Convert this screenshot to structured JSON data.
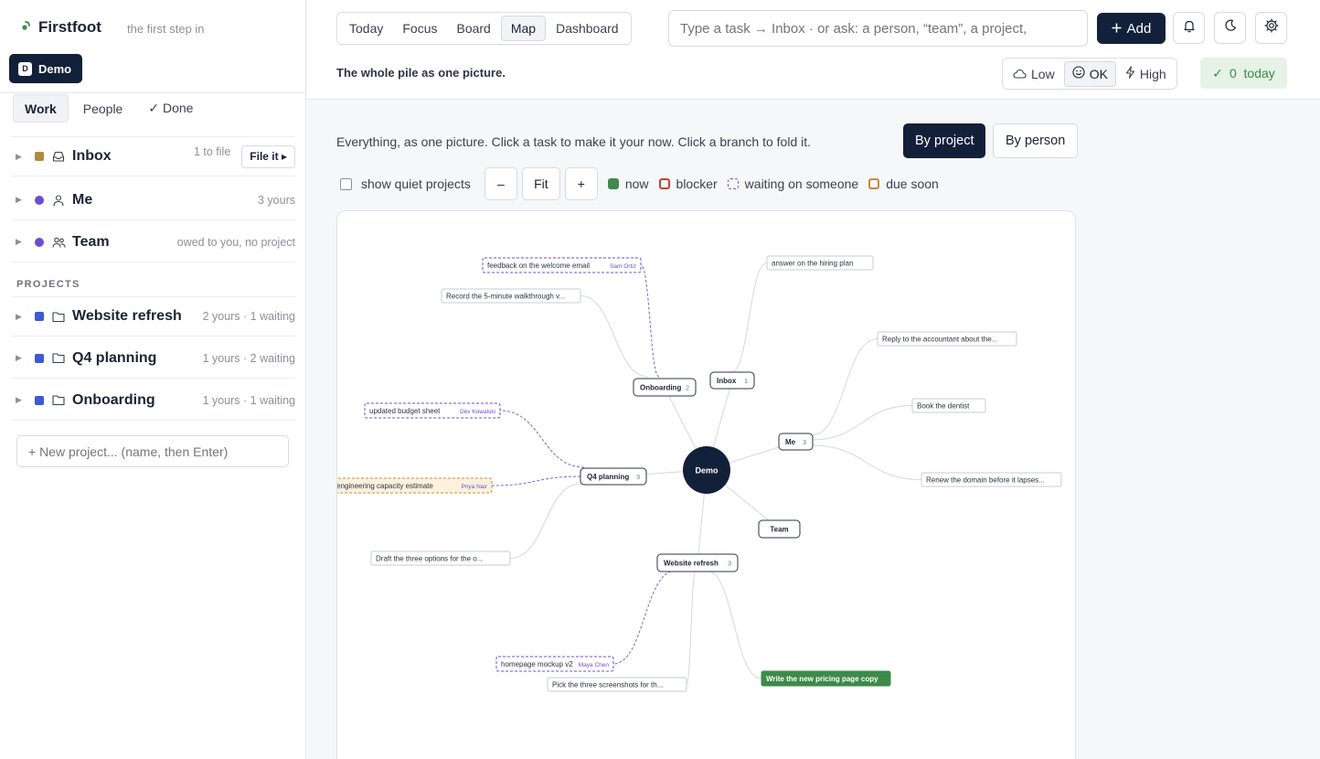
{
  "brand": {
    "name": "Firstfoot",
    "tagline": "the first step in"
  },
  "workspace": {
    "initial": "D",
    "name": "Demo"
  },
  "side_tabs": [
    {
      "label": "Work",
      "active": true
    },
    {
      "label": "People",
      "active": false
    },
    {
      "label": "✓ Done",
      "active": false
    }
  ],
  "buckets": [
    {
      "label": "Inbox",
      "meta": "1 to file",
      "action": "File it ▸",
      "color": "#b08a3e",
      "icon": "inbox-icon"
    },
    {
      "label": "Me",
      "meta": "3 yours",
      "color": "#6b4fd0",
      "icon": "person-icon"
    },
    {
      "label": "Team",
      "meta": "owed to you, no project",
      "color": "#6b4fd0",
      "icon": "people-icon"
    }
  ],
  "projects_label": "PROJECTS",
  "projects": [
    {
      "label": "Website refresh",
      "meta": "2 yours · 1 waiting",
      "color": "#3b5bd6",
      "icon": "folder-icon"
    },
    {
      "label": "Q4 planning",
      "meta": "1 yours · 2 waiting",
      "color": "#3b5bd6",
      "icon": "folder-icon"
    },
    {
      "label": "Onboarding",
      "meta": "1 yours · 1 waiting",
      "color": "#3b5bd6",
      "icon": "folder-icon"
    }
  ],
  "new_project_placeholder": "+ New project... (name, then Enter)",
  "views": [
    {
      "label": "Today",
      "active": false
    },
    {
      "label": "Focus",
      "active": false
    },
    {
      "label": "Board",
      "active": false
    },
    {
      "label": "Map",
      "active": true
    },
    {
      "label": "Dashboard",
      "active": false
    }
  ],
  "quick_add_placeholder": "Type a task → Inbox · or ask: a person, “team”, a project,",
  "add_label": "Add",
  "subtitle": "The whole pile as one picture.",
  "energy": [
    {
      "label": "Low",
      "icon": "cloud-icon",
      "active": false
    },
    {
      "label": "OK",
      "icon": "smile-icon",
      "active": true
    },
    {
      "label": "High",
      "icon": "bolt-icon",
      "active": false
    }
  ],
  "today_badge": {
    "check": "✓",
    "label": "0  today"
  },
  "intro": "Everything, as one picture. Click a task to make it your now. Click a branch to fold it.",
  "group_by": [
    {
      "label": "By project",
      "active": true
    },
    {
      "label": "By person",
      "active": false
    }
  ],
  "controls": {
    "quiet_label": "show quiet projects",
    "zoom_out": "–",
    "fit": "Fit",
    "zoom_in": "+"
  },
  "legend": [
    {
      "label": "now",
      "kind": "now",
      "color": "#3d8a4a"
    },
    {
      "label": "blocker",
      "kind": "blocker",
      "color": "#c2413b"
    },
    {
      "label": "waiting on someone",
      "kind": "waiting",
      "color": "#6b4fd0"
    },
    {
      "label": "due soon",
      "kind": "due",
      "color": "#c48a3a"
    }
  ],
  "map": {
    "root": "Demo",
    "hubs": [
      {
        "id": "onboarding",
        "label": "Onboarding",
        "count": "2"
      },
      {
        "id": "inbox",
        "label": "Inbox",
        "count": "1"
      },
      {
        "id": "me",
        "label": "Me",
        "count": "3"
      },
      {
        "id": "q4",
        "label": "Q4 planning",
        "count": "3"
      },
      {
        "id": "team",
        "label": "Team",
        "count": ""
      },
      {
        "id": "website",
        "label": "Website refresh",
        "count": "3"
      }
    ],
    "tasks": [
      {
        "hub": "onboarding",
        "label": "feedback on the welcome email",
        "person": "Sam Ortiz",
        "kind": "waiting"
      },
      {
        "hub": "onboarding",
        "label": "Record the 5-minute walkthrough v...",
        "kind": "normal"
      },
      {
        "hub": "inbox",
        "label": "answer on the hiring plan",
        "kind": "normal"
      },
      {
        "hub": "me",
        "label": "Reply to the accountant about the...",
        "kind": "normal"
      },
      {
        "hub": "me",
        "label": "Book the dentist",
        "kind": "normal"
      },
      {
        "hub": "me",
        "label": "Renew the domain before it lapses...",
        "kind": "normal"
      },
      {
        "hub": "q4",
        "label": "updated budget sheet",
        "person": "Dev Kowalski",
        "kind": "waiting"
      },
      {
        "hub": "q4",
        "label": "engineering capacity estimate",
        "person": "Priya Nair",
        "kind": "due"
      },
      {
        "hub": "q4",
        "label": "Draft the three options for the o...",
        "kind": "normal"
      },
      {
        "hub": "website",
        "label": "homepage mockup v2",
        "person": "Maya Chen",
        "kind": "waiting"
      },
      {
        "hub": "website",
        "label": "Pick the three screenshots for th...",
        "kind": "normal"
      },
      {
        "hub": "website",
        "label": "Write the new pricing page copy",
        "kind": "now"
      }
    ]
  }
}
